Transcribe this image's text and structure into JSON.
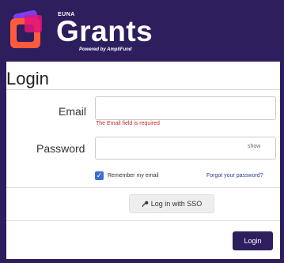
{
  "brand": {
    "company": "EUNA",
    "product": "Grants",
    "tagline": "Powered by AmpliFund",
    "colors": {
      "header": "#2e1e5e",
      "logo_purple": "#7a3ff2",
      "logo_orange": "#ff5a3c",
      "logo_pink": "#e3147a"
    }
  },
  "form": {
    "title": "Login",
    "email": {
      "label": "Email",
      "value": "",
      "placeholder": "",
      "error": "The Email field is required"
    },
    "password": {
      "label": "Password",
      "value": "",
      "placeholder": "",
      "toggle": "show"
    },
    "remember": {
      "label": "Remember my email",
      "checked": true
    },
    "forgot_link": "Forgot your password?",
    "sso_button": {
      "label": "Log in with SSO",
      "icon": "key-icon"
    },
    "submit_button": "Login"
  }
}
